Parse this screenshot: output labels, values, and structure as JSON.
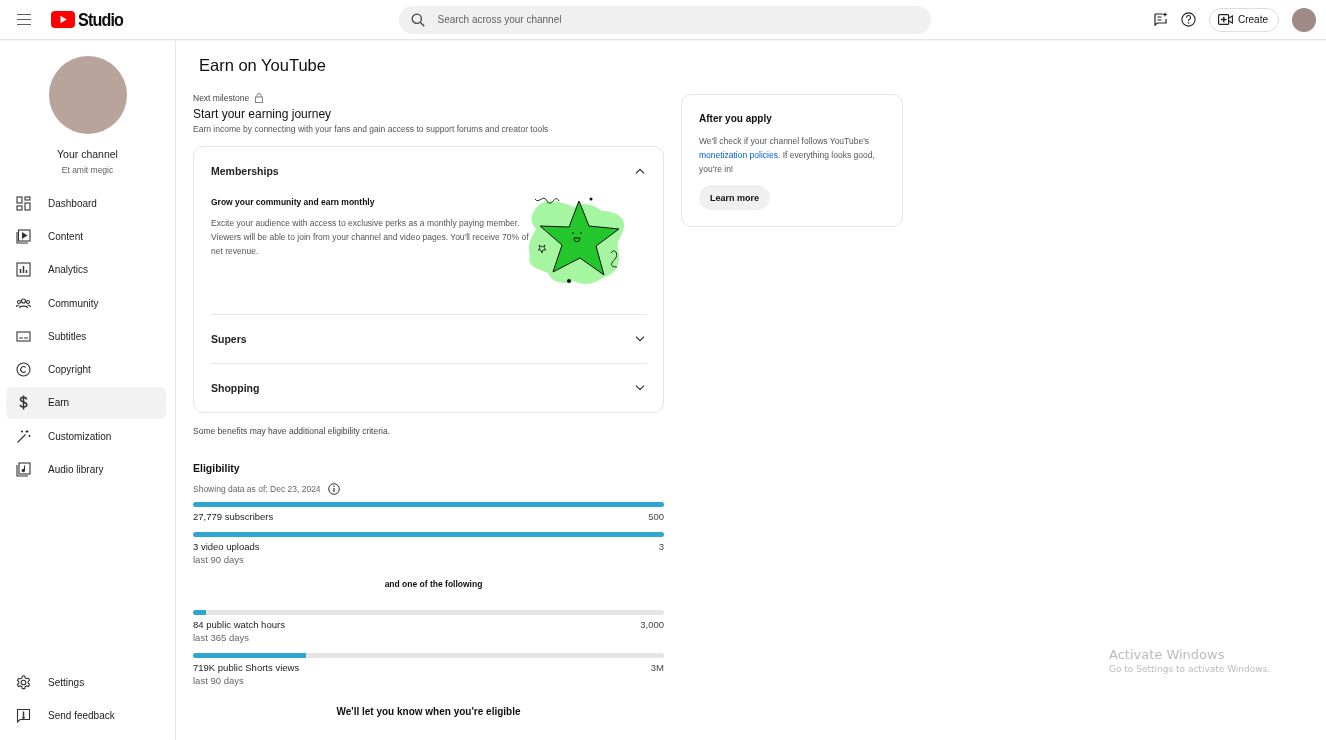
{
  "header": {
    "logo_text": "Studio",
    "search": {
      "placeholder": "Search across your channel"
    },
    "create_button": "Create"
  },
  "sidebar": {
    "channel": {
      "title": "Your channel",
      "name": "Et amit megic"
    },
    "items": [
      {
        "label": "Dashboard",
        "kind": "dashboard",
        "selected": false
      },
      {
        "label": "Content",
        "kind": "content",
        "selected": false
      },
      {
        "label": "Analytics",
        "kind": "analytics",
        "selected": false
      },
      {
        "label": "Community",
        "kind": "community",
        "selected": false
      },
      {
        "label": "Subtitles",
        "kind": "subtitles",
        "selected": false
      },
      {
        "label": "Copyright",
        "kind": "copyright",
        "selected": false
      },
      {
        "label": "Earn",
        "kind": "earn",
        "selected": true
      },
      {
        "label": "Customization",
        "kind": "customization",
        "selected": false
      },
      {
        "label": "Audio library",
        "kind": "audio",
        "selected": false
      }
    ],
    "footer_items": [
      {
        "label": "Settings",
        "kind": "settings"
      },
      {
        "label": "Send feedback",
        "kind": "feedback"
      }
    ]
  },
  "page": {
    "title": "Earn on YouTube",
    "milestone_label": "Next milestone",
    "heading": "Start your earning journey",
    "subheading": "Earn income by connecting with your fans and gain access to support forums and creator tools",
    "benefits": [
      {
        "title": "Memberships",
        "expanded": true,
        "subtitle": "Grow your community and earn monthly",
        "body": "Excite your audience with access to exclusive perks as a monthly paying member. Viewers will be able to join from your channel and video pages. You'll receive 70% of net revenue."
      },
      {
        "title": "Supers",
        "expanded": false
      },
      {
        "title": "Shopping",
        "expanded": false
      }
    ],
    "note": "Some benefits may have additional eligibility criteria.",
    "eligibility": {
      "title": "Eligibility",
      "data_date": "Showing data as of: Dec 23, 2024",
      "required": [
        {
          "label": "27,779 subscribers",
          "target": "500",
          "level": 1
        },
        {
          "label": "3 video uploads",
          "period": "last 90 days",
          "target": "3",
          "level": 1
        }
      ],
      "connector": "and one of the following",
      "any_of": [
        {
          "label": "84 public watch hours",
          "period": "last 365 days",
          "target": "3,000",
          "level": 0.028
        },
        {
          "label": "719K public Shorts views",
          "period": "last 90 days",
          "target": "3M",
          "level": 0.24
        }
      ],
      "footer": "We'll let you know when you're eligible"
    }
  },
  "after_apply": {
    "title": "After you apply",
    "text_before": "We'll check if your channel follows YouTube's ",
    "link": "monetization policies",
    "text_after": ". If everything looks good, you're in!",
    "button": "Learn more"
  },
  "os_notice": {
    "title": "Activate Windows",
    "text": "Go to Settings to activate Windows."
  }
}
